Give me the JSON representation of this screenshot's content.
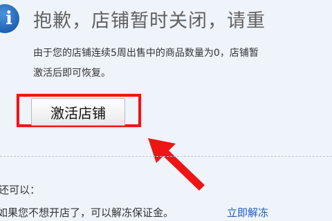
{
  "notice": {
    "title": "抱歉，店铺暂时关闭，请重",
    "message_line1": "由于您的店铺连续5周出售中的商品数量为0，店铺暂",
    "message_line2": "激活后即可恢复。",
    "activate_button": "激活店铺",
    "icon": "info-icon",
    "highlight_color": "#ee1515"
  },
  "alternative": {
    "label": "还可以：",
    "text": "如果您不想开店了，可以解冻保证金。",
    "link": "立即解冻"
  }
}
